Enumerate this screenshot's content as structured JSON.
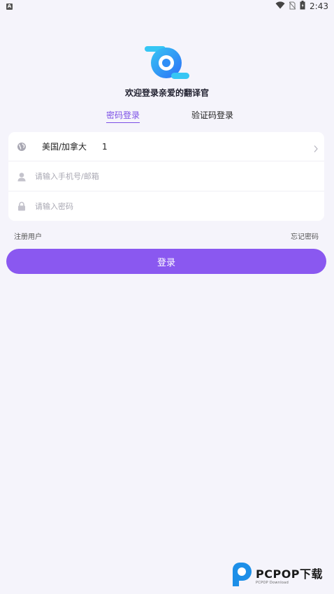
{
  "status_bar": {
    "notification_badge": "A",
    "time": "2:43",
    "icons": [
      "wifi-icon",
      "no-sim-icon",
      "battery-icon"
    ]
  },
  "app": {
    "welcome": "欢迎登录亲爱的翻译官",
    "accent_color": "#8a58f0",
    "logo_colors": [
      "#2e7cf6",
      "#36c6f4"
    ]
  },
  "tabs": {
    "password_login": "密码登录",
    "code_login": "验证码登录",
    "active": "password_login"
  },
  "form": {
    "country_name": "美国/加拿大",
    "country_code": "1",
    "phone_placeholder": "请输入手机号/邮箱",
    "phone_value": "",
    "password_placeholder": "请输入密码",
    "password_value": "",
    "icons": [
      "globe-icon",
      "user-icon",
      "lock-icon",
      "chevron-right-icon"
    ]
  },
  "links": {
    "register": "注册用户",
    "forgot_password": "忘记密码"
  },
  "login_button": "登录",
  "watermark": {
    "main": "PCPOP下载",
    "sub": "PCPOP Download"
  }
}
